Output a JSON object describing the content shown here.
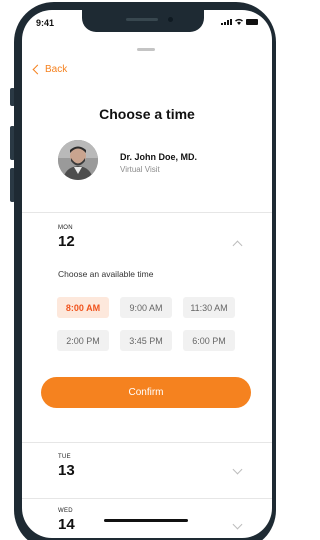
{
  "status_bar": {
    "time": "9:41"
  },
  "nav": {
    "back_label": "Back"
  },
  "page": {
    "title": "Choose a time"
  },
  "provider": {
    "name": "Dr. John Doe, MD.",
    "visit_type": "Virtual Visit"
  },
  "days": [
    {
      "weekday": "MON",
      "date": "12",
      "expanded": true,
      "prompt": "Choose an available time",
      "slots": [
        {
          "label": "8:00 AM",
          "selected": true
        },
        {
          "label": "9:00 AM",
          "selected": false
        },
        {
          "label": "11:30 AM",
          "selected": false
        },
        {
          "label": "2:00 PM",
          "selected": false
        },
        {
          "label": "3:45 PM",
          "selected": false
        },
        {
          "label": "6:00 PM",
          "selected": false
        }
      ],
      "confirm_label": "Confirm"
    },
    {
      "weekday": "TUE",
      "date": "13",
      "expanded": false
    },
    {
      "weekday": "WED",
      "date": "14",
      "expanded": false
    }
  ],
  "colors": {
    "accent": "#f5821f",
    "selected_text": "#f0531d",
    "selected_bg": "#fde8dc",
    "slot_bg": "#f1f1f1",
    "frame": "#1e2a33"
  }
}
